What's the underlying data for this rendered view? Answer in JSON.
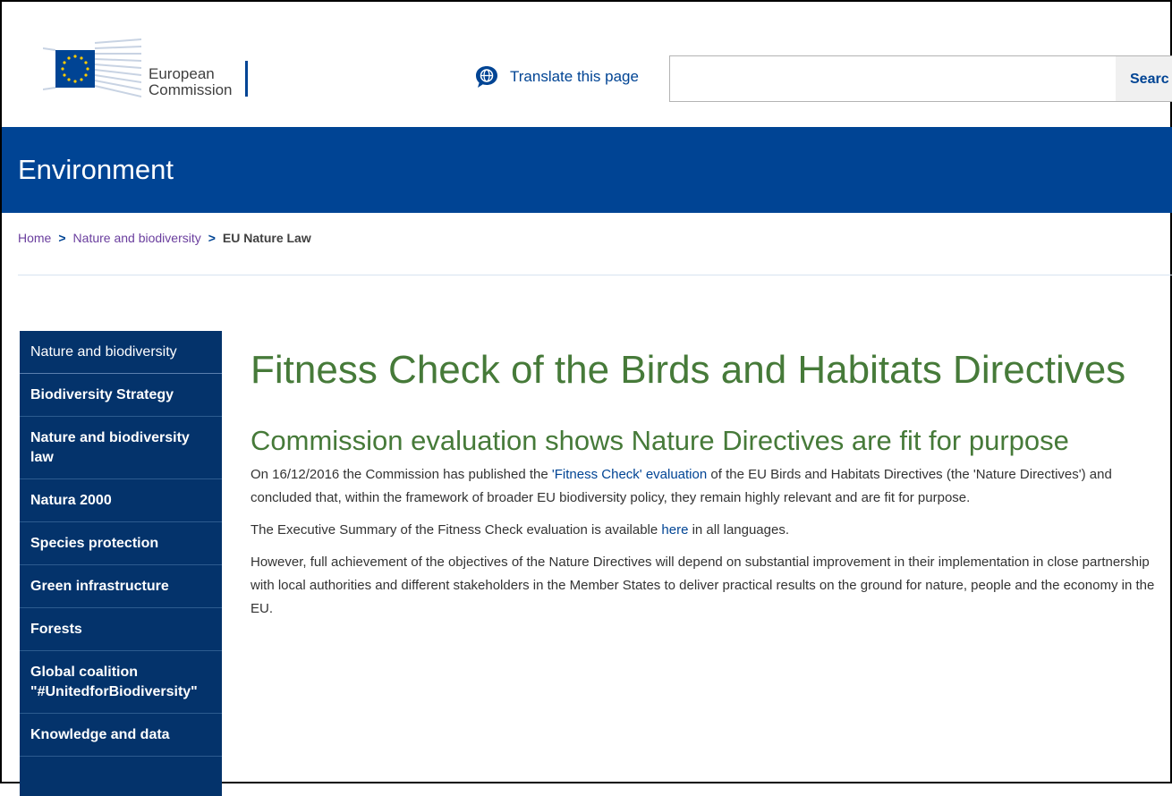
{
  "header": {
    "logo_line1": "European",
    "logo_line2": "Commission",
    "translate_label": "Translate this page",
    "search_placeholder": "",
    "search_button": "Searc"
  },
  "band": {
    "title": "Environment"
  },
  "breadcrumb": {
    "home": "Home",
    "level2": "Nature and biodiversity",
    "current": "EU Nature Law",
    "separator": ">"
  },
  "sidebar": {
    "items": [
      {
        "label": "Nature and biodiversity"
      },
      {
        "label": "Biodiversity Strategy"
      },
      {
        "label": "Nature and biodiversity law"
      },
      {
        "label": "Natura 2000"
      },
      {
        "label": "Species protection"
      },
      {
        "label": "Green infrastructure"
      },
      {
        "label": "Forests"
      },
      {
        "label": "Global coalition \"#UnitedforBiodiversity\""
      },
      {
        "label": "Knowledge and data"
      }
    ]
  },
  "content": {
    "title": "Fitness Check of the Birds and Habitats Directives",
    "subtitle": "Commission evaluation shows Nature Directives are fit for purpose",
    "p1_a": "On 16/12/2016 the Commission has published the ",
    "p1_link": "'Fitness Check' evaluation",
    "p1_b": " of the EU Birds and Habitats Directives (the 'Nature Directives') and concluded that, within the framework of broader EU biodiversity policy, they remain highly relevant and are fit for purpose.",
    "p2_a": "The Executive Summary of the Fitness Check evaluation is available ",
    "p2_link": "here",
    "p2_b": " in all languages.",
    "p3": "However, full achievement of the objectives of the Nature Directives will depend on substantial improvement in their implementation in close partnership with local authorities and different stakeholders in the Member States to deliver practical results on the ground for nature, people and the economy in the EU."
  },
  "colors": {
    "brand_blue": "#004494",
    "sidebar_blue": "#04336b",
    "heading_green": "#467a39",
    "eu_yellow": "#ffcc00"
  }
}
